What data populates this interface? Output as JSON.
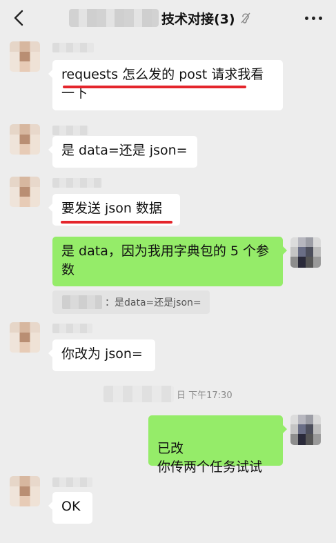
{
  "header": {
    "title": "技术对接(3)"
  },
  "messages": [
    {
      "side": "left",
      "text": "requests 怎么发的 post 请求我看一下"
    },
    {
      "side": "left",
      "text": "是 data=还是 json="
    },
    {
      "side": "left",
      "text": "要发送 json 数据"
    },
    {
      "side": "right",
      "text": "是 data，因为我用字典包的 5 个参数"
    },
    {
      "side": "left",
      "text": "你改为 json="
    },
    {
      "side": "right",
      "text": "已改\n你传两个任务试试"
    },
    {
      "side": "left",
      "text": "OK"
    }
  ],
  "quote": {
    "text": "：是data=还是json="
  },
  "timestamp": {
    "text": "日 下午17:30"
  },
  "colors": {
    "background": "#ededed",
    "my_bubble": "#95ec69",
    "other_bubble": "#ffffff",
    "highlight_underline": "#e4252b"
  }
}
